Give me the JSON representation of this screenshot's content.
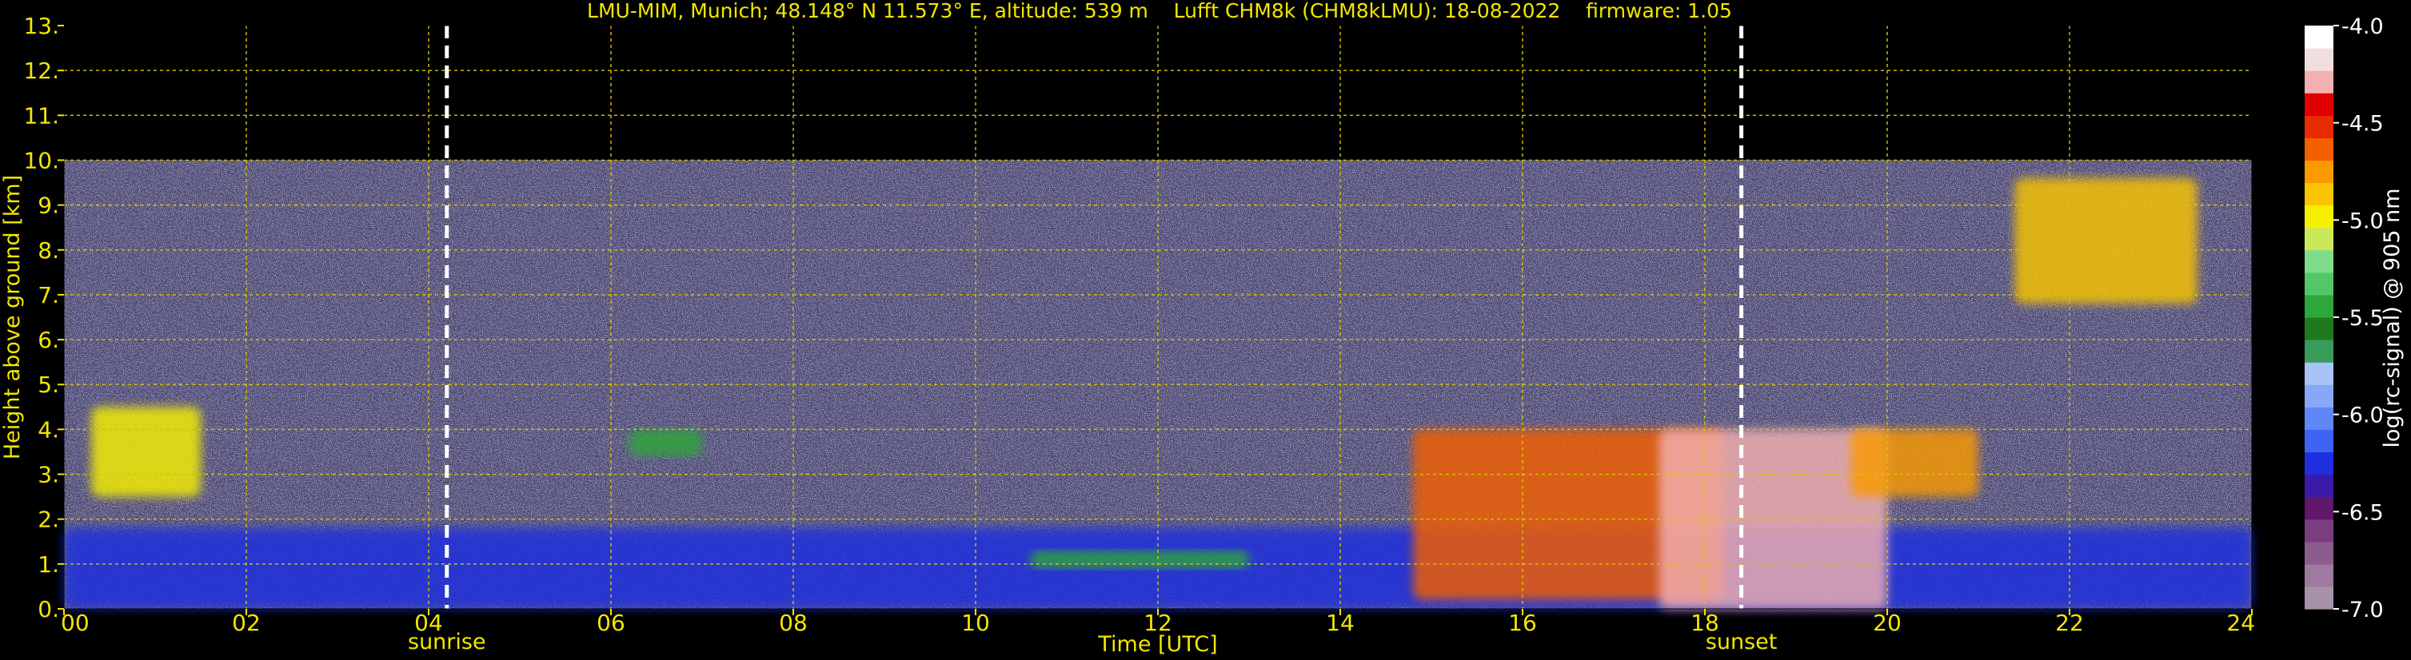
{
  "chart_data": {
    "type": "heatmap",
    "title": "LMU-MIM, Munich; 48.148° N 11.573° E, altitude: 539 m    Lufft CHM8k (CHM8kLMU): 18-08-2022    firmware: 1.05",
    "xlabel": "Time [UTC]",
    "ylabel": "Height above ground [km]",
    "xlim": [
      0,
      24
    ],
    "ylim": [
      0,
      13
    ],
    "x_ticks": [
      0,
      2,
      4,
      6,
      8,
      10,
      12,
      14,
      16,
      18,
      20,
      22,
      24
    ],
    "x_tick_labels": [
      "00",
      "02",
      "04",
      "06",
      "08",
      "10",
      "12",
      "14",
      "16",
      "18",
      "20",
      "22",
      "24"
    ],
    "y_ticks": [
      0,
      1,
      2,
      3,
      4,
      5,
      6,
      7,
      8,
      9,
      10,
      11,
      12,
      13
    ],
    "y_tick_labels": [
      "0.",
      "1.",
      "2.",
      "3.",
      "4.",
      "5.",
      "6.",
      "7.",
      "8.",
      "9.",
      "10.",
      "11.",
      "12.",
      "13."
    ],
    "grid": true,
    "measurement_top_km": 10,
    "markers": [
      {
        "label": "sunrise",
        "time_utc": 4.2
      },
      {
        "label": "sunset",
        "time_utc": 18.4
      }
    ],
    "colorbar": {
      "label": "log(rc-signal) @ 905 nm",
      "range": [
        -7.0,
        -4.0
      ],
      "ticks": [
        -4.0,
        -4.5,
        -5.0,
        -5.5,
        -6.0,
        -6.5,
        -7.0
      ],
      "tick_labels": [
        "-4.0",
        "-4.5",
        "-5.0",
        "-5.5",
        "-6.0",
        "-6.5",
        "-7.0"
      ]
    },
    "features": [
      {
        "feature": "aerosol layer",
        "t0": 0,
        "t1": 24,
        "h0": 0,
        "h1": 1.8,
        "value": -6.3
      },
      {
        "feature": "cloud",
        "t0": 0.3,
        "t1": 1.5,
        "h0": 2.5,
        "h1": 4.5,
        "value": -5.0
      },
      {
        "feature": "cloud",
        "t0": 6.2,
        "t1": 7.0,
        "h0": 3.4,
        "h1": 4.0,
        "value": -5.5
      },
      {
        "feature": "cloud",
        "t0": 10.6,
        "t1": 13.0,
        "h0": 0.9,
        "h1": 1.3,
        "value": -5.5
      },
      {
        "feature": "cloud",
        "t0": 14.8,
        "t1": 18.2,
        "h0": 0.2,
        "h1": 4.0,
        "value": -4.6
      },
      {
        "feature": "cloud",
        "t0": 17.5,
        "t1": 20.0,
        "h0": 0.0,
        "h1": 4.0,
        "value": -4.3
      },
      {
        "feature": "cloud",
        "t0": 19.6,
        "t1": 21.0,
        "h0": 2.5,
        "h1": 4.0,
        "value": -4.8
      },
      {
        "feature": "cirrus",
        "t0": 21.4,
        "t1": 23.4,
        "h0": 6.8,
        "h1": 9.6,
        "value": -4.9
      }
    ]
  },
  "colors": {
    "text": "#f2e600",
    "grid": "#d8c400",
    "background": "#000000",
    "noise": "#4a4670",
    "markers": "#ffffff"
  }
}
